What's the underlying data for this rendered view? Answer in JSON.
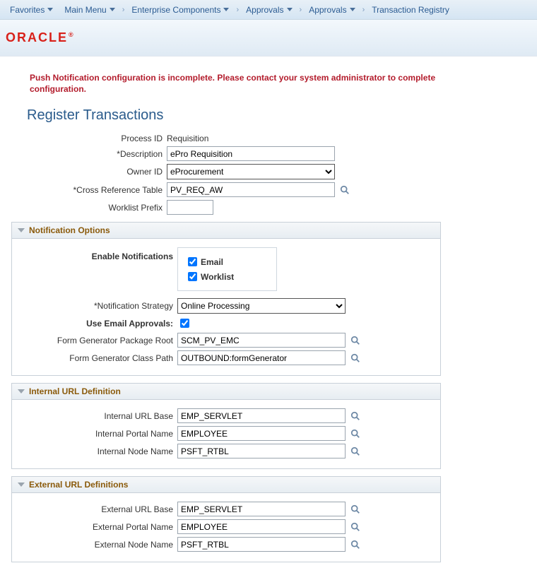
{
  "nav": {
    "favorites": "Favorites",
    "main_menu": "Main Menu",
    "enterprise_components": "Enterprise Components",
    "approvals1": "Approvals",
    "approvals2": "Approvals",
    "transaction_registry": "Transaction Registry"
  },
  "logo": {
    "text": "ORACLE"
  },
  "alert": "Push Notification configuration is incomplete. Please contact your system administrator to complete configuration.",
  "page_title": "Register Transactions",
  "fields": {
    "process_id": {
      "label": "Process ID",
      "value": "Requisition"
    },
    "description": {
      "label": "*Description",
      "value": "ePro Requisition"
    },
    "owner_id": {
      "label": "Owner ID",
      "value": "eProcurement",
      "options": [
        "eProcurement"
      ]
    },
    "cross_ref_table": {
      "label": "*Cross Reference Table",
      "value": "PV_REQ_AW"
    },
    "worklist_prefix": {
      "label": "Worklist Prefix",
      "value": ""
    }
  },
  "notification": {
    "title": "Notification Options",
    "enable_label": "Enable Notifications",
    "email": {
      "label": "Email",
      "checked": true
    },
    "worklist": {
      "label": "Worklist",
      "checked": true
    },
    "strategy": {
      "label": "*Notification Strategy",
      "value": "Online Processing",
      "options": [
        "Online Processing"
      ]
    },
    "use_email_approvals": {
      "label": "Use Email Approvals:",
      "checked": true
    },
    "pkg_root": {
      "label": "Form Generator Package Root",
      "value": "SCM_PV_EMC"
    },
    "class_path": {
      "label": "Form Generator Class Path",
      "value": "OUTBOUND:formGenerator"
    }
  },
  "internal_url": {
    "title": "Internal URL Definition",
    "base": {
      "label": "Internal URL Base",
      "value": "EMP_SERVLET"
    },
    "portal": {
      "label": "Internal Portal Name",
      "value": "EMPLOYEE"
    },
    "node": {
      "label": "Internal Node Name",
      "value": "PSFT_RTBL"
    }
  },
  "external_url": {
    "title": "External URL Definitions",
    "base": {
      "label": "External URL Base",
      "value": "EMP_SERVLET"
    },
    "portal": {
      "label": "External Portal Name",
      "value": "EMPLOYEE"
    },
    "node": {
      "label": "External Node Name",
      "value": "PSFT_RTBL"
    }
  }
}
